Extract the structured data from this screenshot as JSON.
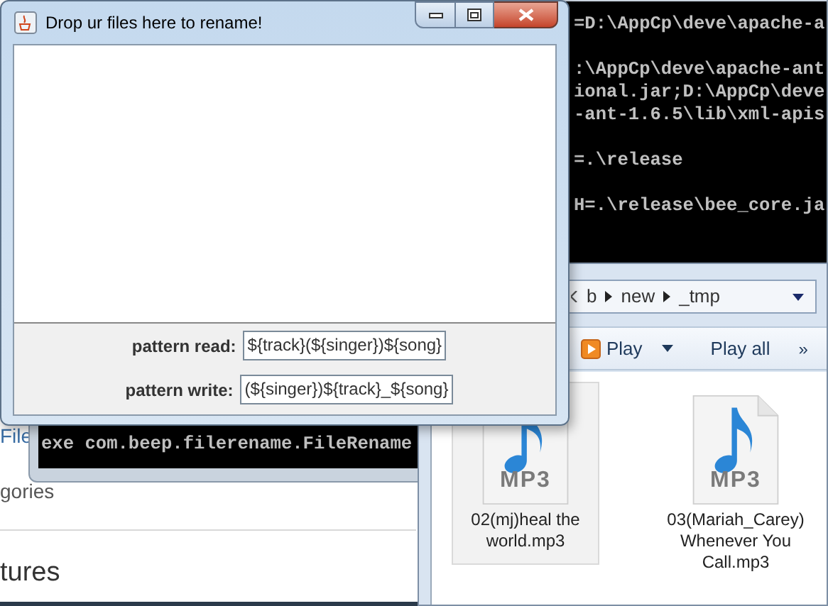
{
  "background_page": {
    "texts": [
      "File",
      "gories",
      "tures"
    ]
  },
  "console_window": {
    "blocks": [
      [
        "=D:\\AppCp\\deve\\apache-a"
      ],
      [
        ":\\AppCp\\deve\\apache-ant",
        "ional.jar;D:\\AppCp\\deve",
        "-ant-1.6.5\\lib\\xml-apis"
      ],
      [
        "=.\\release"
      ],
      [
        "H=.\\release\\bee_core.ja"
      ]
    ],
    "bottom_line": "exe com.beep.filerename.FileRename"
  },
  "explorer_window": {
    "breadcrumb": [
      "b",
      "new",
      "_tmp"
    ],
    "toolbar": [
      {
        "kind": "play",
        "label": "Play"
      },
      {
        "kind": "plain",
        "label": "Play all"
      },
      {
        "kind": "more",
        "label": "»"
      }
    ],
    "files": [
      {
        "name": "02(mj)heal the world.mp3",
        "badge": "MP3",
        "selected": true
      },
      {
        "name": "03(Mariah_Carey) Whenever You Call.mp3",
        "badge": "MP3",
        "selected": false
      }
    ]
  },
  "rename_window": {
    "title": "Drop ur files here to rename!",
    "fields": [
      {
        "label": "pattern read:",
        "value": "${track}(${singer})${song}"
      },
      {
        "label": "pattern write:",
        "value": "(${singer})${track}_${song}"
      }
    ]
  }
}
